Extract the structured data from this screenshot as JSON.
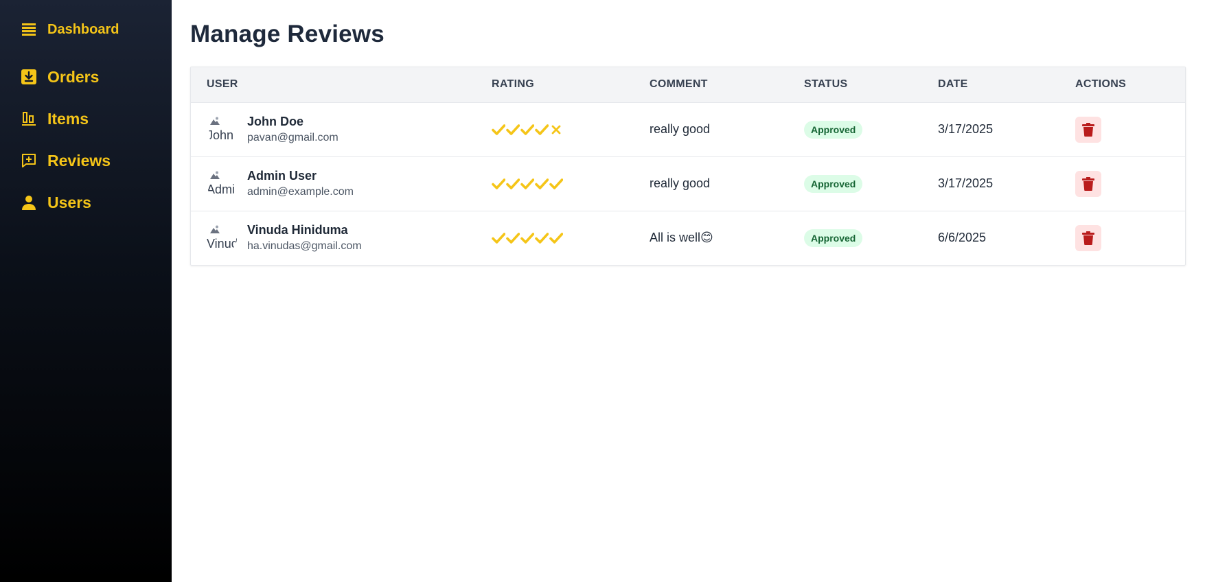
{
  "sidebar": {
    "items": [
      {
        "label": "Dashboard",
        "icon": "list-icon"
      },
      {
        "label": "Orders",
        "icon": "download-icon"
      },
      {
        "label": "Items",
        "icon": "bars-icon"
      },
      {
        "label": "Reviews",
        "icon": "review-icon"
      },
      {
        "label": "Users",
        "icon": "user-icon"
      }
    ]
  },
  "main": {
    "title": "Manage Reviews",
    "table": {
      "headers": [
        "USER",
        "RATING",
        "COMMENT",
        "STATUS",
        "DATE",
        "ACTIONS"
      ],
      "rows": [
        {
          "avatar_alt": "John",
          "name": "John Doe",
          "email": "pavan@gmail.com",
          "rating": 4,
          "comment": "really good",
          "status": "Approved",
          "date": "3/17/2025"
        },
        {
          "avatar_alt": "Admi",
          "name": "Admin User",
          "email": "admin@example.com",
          "rating": 5,
          "comment": "really good",
          "status": "Approved",
          "date": "3/17/2025"
        },
        {
          "avatar_alt": "Vinud",
          "name": "Vinuda Hiniduma",
          "email": "ha.vinudas@gmail.com",
          "rating": 5,
          "comment": "All is well😊",
          "status": "Approved",
          "date": "6/6/2025"
        }
      ]
    }
  },
  "colors": {
    "accent": "#f5c518",
    "badge_bg": "#dcfce7",
    "badge_text": "#166534",
    "delete_bg": "#fee2e2",
    "delete_icon": "#b91c1c"
  }
}
